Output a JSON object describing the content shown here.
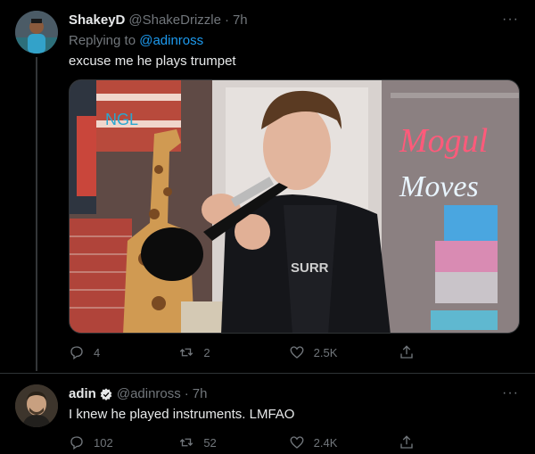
{
  "tweets": [
    {
      "name": "ShakeyD",
      "handle": "@ShakeDrizzle",
      "separator": "·",
      "time": "7h",
      "replying_prefix": "Replying to",
      "replying_to": "@adinross",
      "text": "excuse me he plays trumpet",
      "media": {
        "neon_line1": "Mogul",
        "neon_line2": "Moves",
        "banner_text": "NGL",
        "shirt_text": "SURR"
      },
      "actions": {
        "reply": "4",
        "retweet": "2",
        "like": "2.5K",
        "share": ""
      }
    },
    {
      "name": "adin",
      "handle": "@adinross",
      "separator": "·",
      "time": "7h",
      "verified": true,
      "text": "I knew he played instruments. LMFAO",
      "actions": {
        "reply": "102",
        "retweet": "52",
        "like": "2.4K",
        "share": ""
      }
    }
  ],
  "more_label": "···",
  "colors": {
    "link": "#1d9bf0",
    "muted": "#71767b",
    "bg": "#000000"
  }
}
